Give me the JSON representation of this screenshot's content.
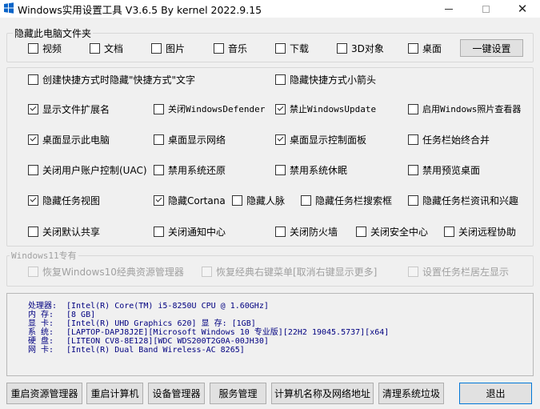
{
  "window": {
    "title": "Windows实用设置工具 V3.6.5 By kernel 2022.9.15",
    "minimize_label": "—",
    "close_label": "✕"
  },
  "hide_folders": {
    "legend": "隐藏此电脑文件夹",
    "items": [
      {
        "label": "视频",
        "checked": false
      },
      {
        "label": "文档",
        "checked": false
      },
      {
        "label": "图片",
        "checked": false
      },
      {
        "label": "音乐",
        "checked": false
      },
      {
        "label": "下载",
        "checked": false
      },
      {
        "label": "3D对象",
        "checked": false
      },
      {
        "label": "桌面",
        "checked": false
      }
    ],
    "apply_button": "一键设置"
  },
  "options": {
    "shortcut_text": {
      "label": "创建快捷方式时隐藏\"快捷方式\"文字",
      "checked": false
    },
    "shortcut_arrow": {
      "label": "隐藏快捷方式小箭头",
      "checked": false
    },
    "row1": [
      {
        "label": "显示文件扩展名",
        "checked": true
      },
      {
        "label": "关闭WindowsDefender",
        "checked": false
      },
      {
        "label": "禁止WindowsUpdate",
        "checked": true
      },
      {
        "label": "启用Windows照片查看器",
        "checked": false
      }
    ],
    "row2": [
      {
        "label": "桌面显示此电脑",
        "checked": true
      },
      {
        "label": "桌面显示网络",
        "checked": false
      },
      {
        "label": "桌面显示控制面板",
        "checked": true
      },
      {
        "label": "任务栏始终合并",
        "checked": false
      }
    ],
    "row3": [
      {
        "label": "关闭用户账户控制(UAC)",
        "checked": false
      },
      {
        "label": "禁用系统还原",
        "checked": false
      },
      {
        "label": "禁用系统休眠",
        "checked": false
      },
      {
        "label": "禁用预览桌面",
        "checked": false
      }
    ],
    "row4": [
      {
        "label": "隐藏任务视图",
        "checked": true
      },
      {
        "label": "隐藏Cortana",
        "checked": true
      },
      {
        "label": "隐藏人脉",
        "checked": false
      },
      {
        "label": "隐藏任务栏搜索框",
        "checked": false
      },
      {
        "label": "隐藏任务栏资讯和兴趣",
        "checked": false
      }
    ],
    "row5": [
      {
        "label": "关闭默认共享",
        "checked": false
      },
      {
        "label": "关闭通知中心",
        "checked": false
      },
      {
        "label": "关闭防火墙",
        "checked": false
      },
      {
        "label": "关闭安全中心",
        "checked": false
      },
      {
        "label": "关闭远程协助",
        "checked": false
      }
    ]
  },
  "win11": {
    "legend": "Windows11专有",
    "items": [
      {
        "label": "恢复Windows10经典资源管理器",
        "checked": false
      },
      {
        "label": "恢复经典右键菜单[取消右键显示更多]",
        "checked": false
      },
      {
        "label": "设置任务栏居左显示",
        "checked": false
      }
    ]
  },
  "system_info": [
    {
      "label": "处理器:",
      "value": "[Intel(R) Core(TM) i5-8250U CPU @ 1.60GHz]"
    },
    {
      "label": "内  存:",
      "value": "[8 GB]"
    },
    {
      "label": "显  卡:",
      "value": "[Intel(R) UHD Graphics 620]  显 存: [1GB]"
    },
    {
      "label": "系  统:",
      "value": "[LAPTOP-DAPJ8J2E][Microsoft Windows 10 专业版][22H2 19045.5737][x64]"
    },
    {
      "label": "硬  盘:",
      "value": "[LITEON CV8-8E128][WDC WDS200T2G0A-00JH30]"
    },
    {
      "label": "网  卡:",
      "value": "[Intel(R) Dual Band Wireless-AC 8265]"
    }
  ],
  "bottom_buttons": {
    "restart_explorer": "重启资源管理器",
    "restart_computer": "重启计算机",
    "device_manager": "设备管理器",
    "service_manager": "服务管理",
    "computer_name_network": "计算机名称及网络地址",
    "clean_junk": "清理系统垃圾",
    "exit": "退出"
  }
}
